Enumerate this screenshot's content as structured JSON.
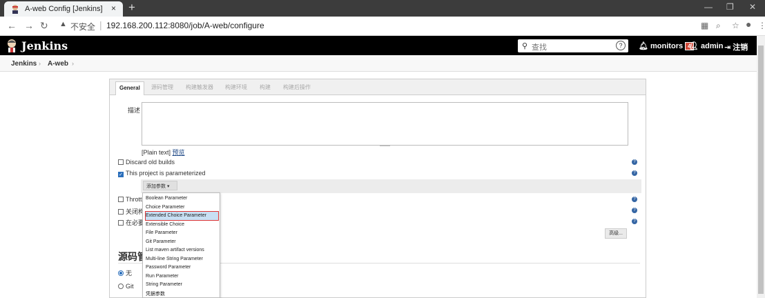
{
  "browser": {
    "tab_title": "A-web Config [Jenkins]",
    "close_glyph": "×",
    "new_tab_glyph": "+",
    "insecure_label": "不安全",
    "url": "192.168.200.112:8080/job/A-web/configure"
  },
  "header": {
    "title": "Jenkins",
    "search_placeholder": "查找",
    "help_glyph": "?",
    "monitors_label": "monitors",
    "monitors_count": "4",
    "user_label": "admin",
    "logout_label": "注销"
  },
  "breadcrumb": {
    "items": [
      "Jenkins",
      "A-web"
    ]
  },
  "config_tabs": [
    "General",
    "源码管理",
    "构建触发器",
    "构建环境",
    "构建",
    "构建后操作"
  ],
  "general": {
    "description_label": "描述",
    "plain_text": "[Plain text]",
    "preview_link": "预览",
    "discard_old_builds": "Discard old builds",
    "parameterized": "This project is parameterized",
    "add_parameter_button": "添加参数 ▾",
    "throttle_label": "Throttle",
    "option_close": "关闭构",
    "option_required": "在必要的",
    "advanced_button": "高级..."
  },
  "add_parameter_menu": {
    "items": [
      "Boolean Parameter",
      "Choice Parameter",
      "Extended Choice Parameter",
      "Extensible Choice",
      "File Parameter",
      "Git Parameter",
      "List maven artifact versions",
      "Multi-line String Parameter",
      "Password Parameter",
      "Run Parameter",
      "String Parameter",
      "凭据参数"
    ],
    "selected": "Extended Choice Parameter"
  },
  "scm_section": {
    "title": "源码管理",
    "option_none": "无",
    "option_git": "Git"
  },
  "colors": {
    "header_bg": "#000000",
    "accent_blue": "#2a6ebb",
    "badge_red": "#d24939",
    "highlight_red": "#dd3333"
  }
}
